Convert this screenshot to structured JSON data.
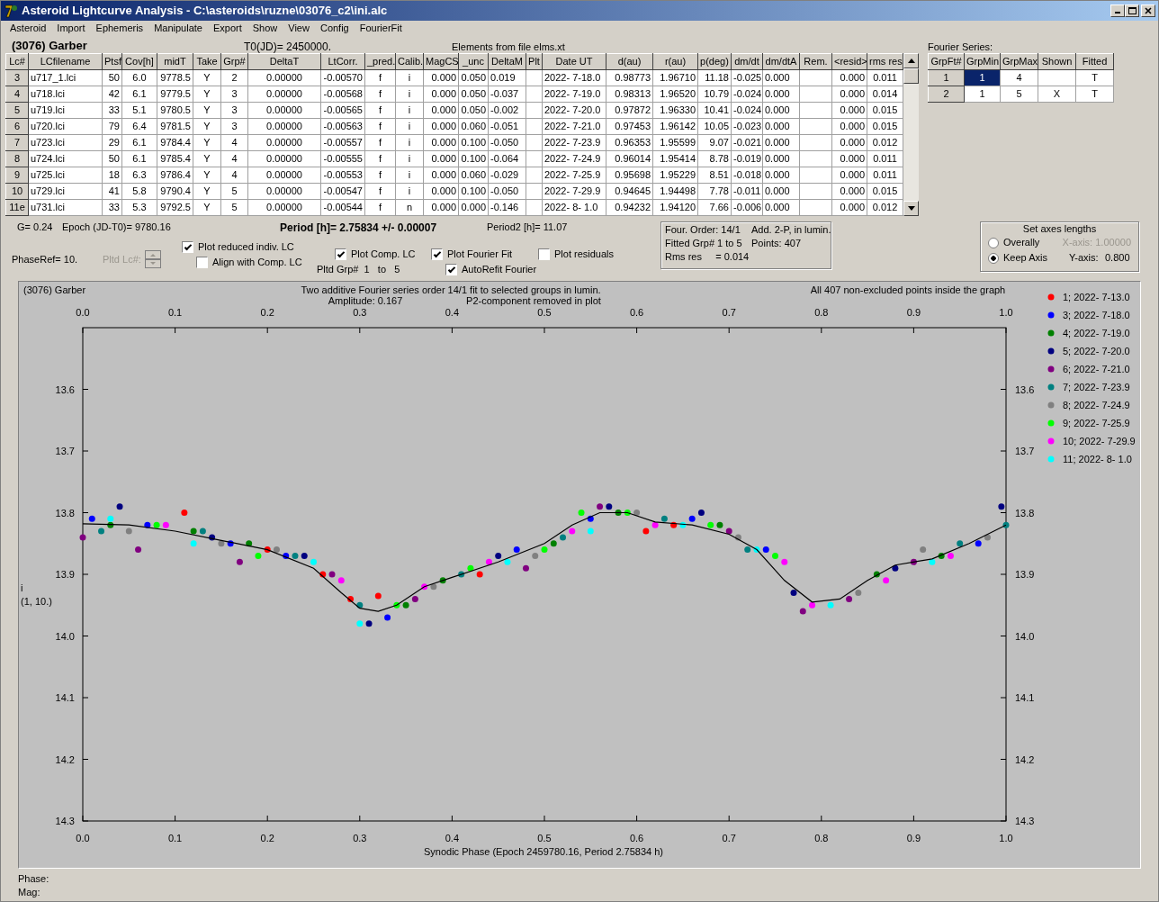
{
  "window": {
    "title": "Asteroid Lightcurve Analysis - C:\\asteroids\\ruzne\\03076_c2\\ini.alc"
  },
  "menu": [
    "Asteroid",
    "Import",
    "Ephemeris",
    "Manipulate",
    "Export",
    "Show",
    "View",
    "Config",
    "FourierFit"
  ],
  "header": {
    "asteroid": "(3076) Garber",
    "t0": "T0(JD)= 2450000.",
    "elements": "Elements from file elms.xt"
  },
  "lc_table": {
    "columns": [
      "Lc#",
      "LCfilename",
      "Ptsf",
      "Cov[h]",
      "midT",
      "Take",
      "Grp#",
      "DeltaT",
      "LtCorr.",
      "_pred.",
      "Calib.",
      "MagCS",
      "_unc",
      "DeltaM",
      "Plt",
      "Date UT",
      "d(au)",
      "r(au)",
      "p(deg)",
      "dm/dt",
      "dm/dtA",
      "Rem.",
      "<resid>",
      "rms res"
    ],
    "rows": [
      [
        "3",
        "u717_1.lci",
        "50",
        "6.0",
        "9778.5",
        "Y",
        "2",
        "0.00000",
        "-0.00570",
        "f",
        "i",
        "0.000",
        "0.050",
        "0.019",
        null,
        "2022- 7-18.0",
        "0.98773",
        "1.96710",
        "11.18",
        "-0.025",
        "0.000",
        null,
        "0.000",
        "0.011"
      ],
      [
        "4",
        "u718.lci",
        "42",
        "6.1",
        "9779.5",
        "Y",
        "3",
        "0.00000",
        "-0.00568",
        "f",
        "i",
        "0.000",
        "0.050",
        "-0.037",
        null,
        "2022- 7-19.0",
        "0.98313",
        "1.96520",
        "10.79",
        "-0.024",
        "0.000",
        null,
        "0.000",
        "0.014"
      ],
      [
        "5",
        "u719.lci",
        "33",
        "5.1",
        "9780.5",
        "Y",
        "3",
        "0.00000",
        "-0.00565",
        "f",
        "i",
        "0.000",
        "0.050",
        "-0.002",
        null,
        "2022- 7-20.0",
        "0.97872",
        "1.96330",
        "10.41",
        "-0.024",
        "0.000",
        null,
        "0.000",
        "0.015"
      ],
      [
        "6",
        "u720.lci",
        "79",
        "6.4",
        "9781.5",
        "Y",
        "3",
        "0.00000",
        "-0.00563",
        "f",
        "i",
        "0.000",
        "0.060",
        "-0.051",
        null,
        "2022- 7-21.0",
        "0.97453",
        "1.96142",
        "10.05",
        "-0.023",
        "0.000",
        null,
        "0.000",
        "0.015"
      ],
      [
        "7",
        "u723.lci",
        "29",
        "6.1",
        "9784.4",
        "Y",
        "4",
        "0.00000",
        "-0.00557",
        "f",
        "i",
        "0.000",
        "0.100",
        "-0.050",
        null,
        "2022- 7-23.9",
        "0.96353",
        "1.95599",
        "9.07",
        "-0.021",
        "0.000",
        null,
        "0.000",
        "0.012"
      ],
      [
        "8",
        "u724.lci",
        "50",
        "6.1",
        "9785.4",
        "Y",
        "4",
        "0.00000",
        "-0.00555",
        "f",
        "i",
        "0.000",
        "0.100",
        "-0.064",
        null,
        "2022- 7-24.9",
        "0.96014",
        "1.95414",
        "8.78",
        "-0.019",
        "0.000",
        null,
        "0.000",
        "0.011"
      ],
      [
        "9",
        "u725.lci",
        "18",
        "6.3",
        "9786.4",
        "Y",
        "4",
        "0.00000",
        "-0.00553",
        "f",
        "i",
        "0.000",
        "0.060",
        "-0.029",
        null,
        "2022- 7-25.9",
        "0.95698",
        "1.95229",
        "8.51",
        "-0.018",
        "0.000",
        null,
        "0.000",
        "0.011"
      ],
      [
        "10",
        "u729.lci",
        "41",
        "5.8",
        "9790.4",
        "Y",
        "5",
        "0.00000",
        "-0.00547",
        "f",
        "i",
        "0.000",
        "0.100",
        "-0.050",
        null,
        "2022- 7-29.9",
        "0.94645",
        "1.94498",
        "7.78",
        "-0.011",
        "0.000",
        null,
        "0.000",
        "0.015"
      ],
      [
        "11e",
        "u731.lci",
        "33",
        "5.3",
        "9792.5",
        "Y",
        "5",
        "0.00000",
        "-0.00544",
        "f",
        "n",
        "0.000",
        "0.000",
        "-0.146",
        null,
        "2022- 8- 1.0",
        "0.94232",
        "1.94120",
        "7.66",
        "-0.006",
        "0.000",
        null,
        "0.000",
        "0.012"
      ]
    ]
  },
  "fourier_series": {
    "label": "Fourier Series:",
    "columns": [
      "GrpFt#",
      "GrpMin",
      "GrpMax",
      "Shown",
      "Fitted"
    ],
    "rows": [
      {
        "grpft": "1",
        "grpmin": "1",
        "grpmax": "4",
        "fitted": "T",
        "selected": true
      },
      {
        "grpft": "2",
        "grpmin": "1",
        "grpmax": "5",
        "shown": "X",
        "fitted": "T",
        "selected": false
      }
    ]
  },
  "summary": {
    "g": "G= 0.24",
    "epoch": "Epoch (JD-T0)= 9780.16",
    "period": "Period [h]= 2.75834 +/- 0.00007",
    "period2": "Period2 [h]= 11.07",
    "phaseref": "PhaseRef= 10.",
    "pltd_lc": {
      "label": "Pltd Lc#:",
      "disabled": true
    },
    "pltd_grp": "Pltd Grp#  1   to   5"
  },
  "checkboxes": [
    {
      "label": "Plot reduced indiv. LC",
      "checked": true
    },
    {
      "label": "Align with Comp. LC",
      "checked": false
    },
    {
      "label": "Plot Comp. LC",
      "checked": true
    },
    {
      "label": "Plot Fourier Fit",
      "checked": true
    },
    {
      "label": "Plot residuals",
      "checked": false
    },
    {
      "label": "AutoRefit Fourier",
      "checked": true
    }
  ],
  "fit_info": [
    "Four. Order: 14/1",
    "Add. 2-P, in lumin.",
    "Fitted Grp# 1 to 5",
    "Points: 407",
    "Rms res     = 0.014"
  ],
  "axes_lengths": {
    "title": "Set axes lengths",
    "options": [
      {
        "label": "Overally",
        "selected": false
      },
      {
        "label": "Keep Axis",
        "selected": true
      }
    ],
    "axes": [
      {
        "label": "X-axis:",
        "value": "1.00000",
        "disabled": true
      },
      {
        "label": "Y-axis:",
        "value": "0.800",
        "disabled": false
      }
    ]
  },
  "plot": {
    "name": "(3076) Garber",
    "title": "Two additive Fourier series order 14/1 fit to selected groups in lumin.",
    "amplitude": "Amplitude: 0.167",
    "note": "P2-component removed in plot",
    "points_note": "All 407 non-excluded points inside the graph",
    "ylabel_note": "(1, 10.)",
    "right_axis_labels": [
      "13.6",
      "13.7",
      "13.8",
      "13.9",
      "14.0",
      "14.1",
      "14.2",
      "14.3"
    ],
    "chart_data": {
      "type": "scatter",
      "legend": "right",
      "xlabel": "Synodic Phase (Epoch 2459780.16, Period 2.75834 h)",
      "ylabel": "i",
      "xlim": [
        0,
        1
      ],
      "ylim": [
        14.3,
        13.5
      ],
      "xticks": [
        {
          "value": 0,
          "label": "0.0"
        },
        {
          "value": 0.1,
          "label": "0.1"
        },
        {
          "value": 0.2,
          "label": "0.2"
        },
        {
          "value": 0.3,
          "label": "0.3"
        },
        {
          "value": 0.4,
          "label": "0.4"
        },
        {
          "value": 0.5,
          "label": "0.5"
        },
        {
          "value": 0.6,
          "label": "0.6"
        },
        {
          "value": 0.7,
          "label": "0.7"
        },
        {
          "value": 0.8,
          "label": "0.8"
        },
        {
          "value": 0.9,
          "label": "0.9"
        },
        {
          "value": 1,
          "label": "1.0"
        }
      ],
      "yticks": [
        {
          "value": 13.6,
          "label": "13.6"
        },
        {
          "value": 13.7,
          "label": "13.7"
        },
        {
          "value": 13.8,
          "label": "13.8"
        },
        {
          "value": 13.9,
          "label": "13.9"
        },
        {
          "value": 14.0,
          "label": "14.0"
        },
        {
          "value": 14.1,
          "label": "14.1"
        },
        {
          "value": 14.2,
          "label": "14.2"
        },
        {
          "value": 14.3,
          "label": "14.3"
        }
      ],
      "series": [
        {
          "name": "1; 2022- 7-13.0",
          "color": "#ff0000",
          "x": [
            0.11,
            0.2,
            0.26,
            0.29,
            0.32,
            0.43,
            0.61,
            0.64
          ],
          "values": [
            13.8,
            13.86,
            13.9,
            13.94,
            13.935,
            13.9,
            13.83,
            13.82
          ]
        },
        {
          "name": "3; 2022- 7-18.0",
          "color": "#0000ff",
          "x": [
            0.01,
            0.07,
            0.16,
            0.22,
            0.33,
            0.47,
            0.55,
            0.66,
            0.74,
            0.97
          ],
          "values": [
            13.81,
            13.82,
            13.85,
            13.87,
            13.97,
            13.86,
            13.81,
            13.81,
            13.86,
            13.85
          ]
        },
        {
          "name": "4; 2022- 7-19.0",
          "color": "#008000",
          "x": [
            0.03,
            0.12,
            0.18,
            0.35,
            0.39,
            0.51,
            0.58,
            0.69,
            0.86,
            0.93
          ],
          "values": [
            13.82,
            13.83,
            13.85,
            13.95,
            13.91,
            13.85,
            13.8,
            13.82,
            13.9,
            13.87
          ]
        },
        {
          "name": "5; 2022- 7-20.0",
          "color": "#000080",
          "x": [
            0.04,
            0.14,
            0.24,
            0.31,
            0.45,
            0.57,
            0.67,
            0.77,
            0.88,
            0.995
          ],
          "values": [
            13.79,
            13.84,
            13.87,
            13.98,
            13.87,
            13.79,
            13.8,
            13.93,
            13.89,
            13.79
          ]
        },
        {
          "name": "6; 2022- 7-21.0",
          "color": "#800080",
          "x": [
            0.0,
            0.06,
            0.17,
            0.27,
            0.36,
            0.48,
            0.56,
            0.7,
            0.78,
            0.83,
            0.9
          ],
          "values": [
            13.84,
            13.86,
            13.88,
            13.9,
            13.94,
            13.89,
            13.79,
            13.83,
            13.96,
            13.94,
            13.88
          ]
        },
        {
          "name": "7; 2022- 7-23.9",
          "color": "#008080",
          "x": [
            0.02,
            0.13,
            0.23,
            0.3,
            0.41,
            0.52,
            0.63,
            0.72,
            0.95,
            1.0
          ],
          "values": [
            13.83,
            13.83,
            13.87,
            13.95,
            13.9,
            13.84,
            13.81,
            13.86,
            13.85,
            13.82
          ]
        },
        {
          "name": "8; 2022- 7-24.9",
          "color": "#808080",
          "x": [
            0.05,
            0.15,
            0.21,
            0.38,
            0.49,
            0.6,
            0.71,
            0.84,
            0.91,
            0.98
          ],
          "values": [
            13.83,
            13.85,
            13.86,
            13.92,
            13.87,
            13.8,
            13.84,
            13.93,
            13.86,
            13.84
          ]
        },
        {
          "name": "9; 2022- 7-25.9",
          "color": "#00ff00",
          "x": [
            0.08,
            0.19,
            0.34,
            0.42,
            0.5,
            0.54,
            0.59,
            0.68,
            0.75
          ],
          "values": [
            13.82,
            13.87,
            13.95,
            13.89,
            13.86,
            13.8,
            13.8,
            13.82,
            13.87
          ]
        },
        {
          "name": "10; 2022- 7-29.9",
          "color": "#ff00ff",
          "x": [
            0.09,
            0.28,
            0.37,
            0.44,
            0.53,
            0.62,
            0.76,
            0.79,
            0.87,
            0.94
          ],
          "values": [
            13.82,
            13.91,
            13.92,
            13.88,
            13.83,
            13.82,
            13.88,
            13.95,
            13.91,
            13.87
          ]
        },
        {
          "name": "11; 2022- 8- 1.0",
          "color": "#00ffff",
          "x": [
            0.03,
            0.12,
            0.25,
            0.3,
            0.46,
            0.55,
            0.65,
            0.73,
            0.81,
            0.92
          ],
          "values": [
            13.81,
            13.85,
            13.88,
            13.98,
            13.88,
            13.83,
            13.82,
            13.86,
            13.95,
            13.88
          ]
        },
        {
          "type": "line",
          "color": "#000000",
          "x": [
            0,
            0.05,
            0.1,
            0.15,
            0.2,
            0.25,
            0.28,
            0.3,
            0.32,
            0.34,
            0.37,
            0.4,
            0.45,
            0.5,
            0.53,
            0.56,
            0.59,
            0.62,
            0.66,
            0.7,
            0.73,
            0.76,
            0.79,
            0.82,
            0.85,
            0.88,
            0.92,
            0.96,
            1
          ],
          "values": [
            13.818,
            13.82,
            13.83,
            13.845,
            13.86,
            13.89,
            13.93,
            13.955,
            13.96,
            13.95,
            13.92,
            13.905,
            13.88,
            13.85,
            13.82,
            13.8,
            13.8,
            13.815,
            13.82,
            13.835,
            13.86,
            13.91,
            13.945,
            13.94,
            13.91,
            13.885,
            13.875,
            13.85,
            13.82
          ]
        }
      ]
    }
  },
  "status_bar": [
    "Phase:",
    "Mag:"
  ]
}
